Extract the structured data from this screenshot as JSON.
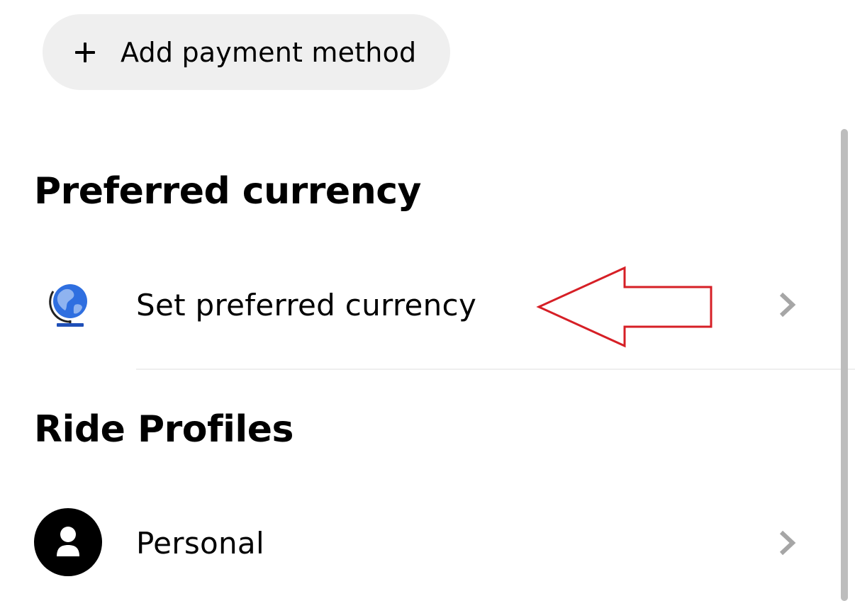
{
  "payment": {
    "add_label": "Add payment method",
    "add_icon": "plus-icon"
  },
  "currency_section": {
    "title": "Preferred currency",
    "row": {
      "label": "Set preferred currency",
      "icon": "globe-icon",
      "trailing_icon": "chevron-right-icon"
    }
  },
  "profiles_section": {
    "title": "Ride Profiles",
    "row": {
      "label": "Personal",
      "icon": "person-avatar-icon",
      "trailing_icon": "chevron-right-icon"
    }
  },
  "colors": {
    "pill_background": "#efefef",
    "annotation_arrow": "#d61f26",
    "chevron": "#a6a6a6",
    "globe_blue": "#2f6fe0"
  }
}
